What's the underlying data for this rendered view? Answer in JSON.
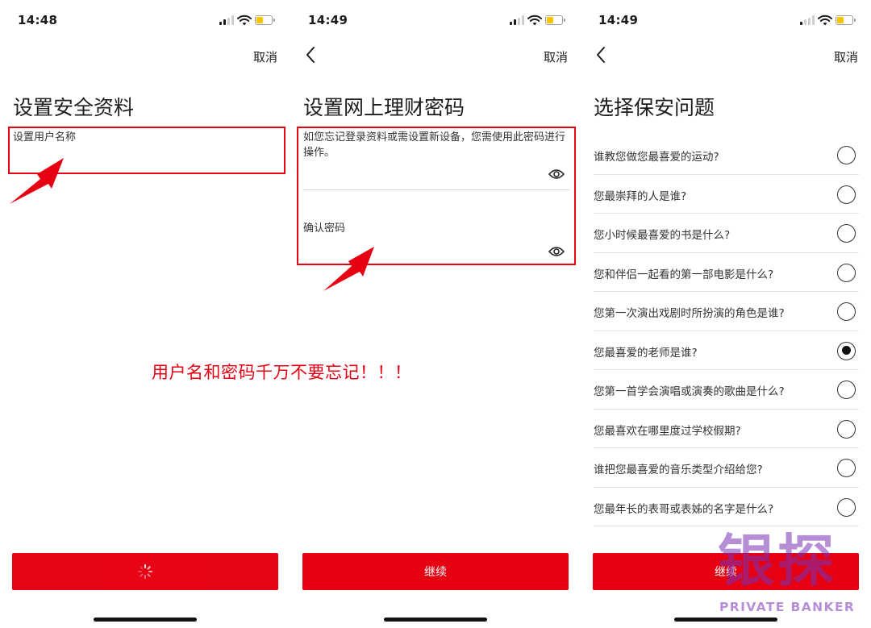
{
  "colors": {
    "brand_red": "#e60012",
    "text": "#1c1c1e",
    "divider": "#e2e2e2",
    "battery": "#f7c600"
  },
  "screen1": {
    "status_time": "14:48",
    "cancel_label": "取消",
    "title": "设置安全资料",
    "username_label": "设置用户名称",
    "button_state": "loading",
    "button_icon": "spinner-icon"
  },
  "screen2": {
    "status_time": "14:49",
    "back_icon": "chevron-left-icon",
    "cancel_label": "取消",
    "title": "设置网上理财密码",
    "password_hint": "如您忘记登录资料或需设置新设备，您需使用此密码进行操作。",
    "confirm_label": "确认密码",
    "eye_icon": "eye-icon",
    "continue_label": "继续"
  },
  "screen3": {
    "status_time": "14:49",
    "back_icon": "chevron-left-icon",
    "cancel_label": "取消",
    "title": "选择保安问题",
    "questions": [
      {
        "text": "谁教您做您最喜爱的运动?",
        "selected": false
      },
      {
        "text": "您最崇拜的人是谁?",
        "selected": false
      },
      {
        "text": "您小时候最喜爱的书是什么?",
        "selected": false
      },
      {
        "text": "您和伴侣一起看的第一部电影是什么?",
        "selected": false
      },
      {
        "text": "您第一次演出戏剧时所扮演的角色是谁?",
        "selected": false
      },
      {
        "text": "您最喜爱的老师是谁?",
        "selected": true
      },
      {
        "text": "您第一首学会演唱或演奏的歌曲是什么?",
        "selected": false
      },
      {
        "text": "您最喜欢在哪里度过学校假期?",
        "selected": false
      },
      {
        "text": "谁把您最喜爱的音乐类型介绍给您?",
        "selected": false
      },
      {
        "text": "您最年长的表哥或表姊的名字是什么?",
        "selected": false
      }
    ],
    "continue_label": "继续"
  },
  "annotation": {
    "text": "用户名和密码千万不要忘记！！！"
  },
  "watermark": {
    "logo": "银探",
    "text": "PRIVATE BANKER"
  }
}
